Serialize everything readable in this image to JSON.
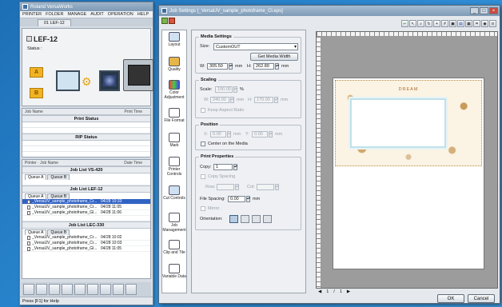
{
  "left_window": {
    "title": "Roland VersaWorks",
    "menu": [
      "PRINTER",
      "FOLDER",
      "MANAGE",
      "AUDIT",
      "OPERATION",
      "HELP"
    ],
    "printer_tab": "01 LEF-12",
    "printer_name": "LEF-12",
    "status_label": "Status :",
    "folder_a": "A",
    "folder_b": "B",
    "job_table_header": {
      "name": "Job Name",
      "time": "Print Time"
    },
    "print_status": "Print Status",
    "rip_status": "RIP Status",
    "queue_table_header": {
      "name": "Printer · Job Name",
      "time": "Date Time"
    },
    "job_list_1": {
      "title": "Job List VS-420",
      "tabs": [
        "Queue A",
        "Queue B"
      ]
    },
    "job_list_2": {
      "title": "Job List LEF-12",
      "tabs": [
        "Queue A",
        "Queue B"
      ],
      "rows": [
        {
          "name": "_VersaUV_sample_photoframe_Cr...",
          "date": "04/28 10:33",
          "selected": true
        },
        {
          "name": "_VersaUV_sample_photoframe_Cr...",
          "date": "04/28 11:05",
          "selected": false
        },
        {
          "name": "_VersaUV_sample_photoframe_Gl...",
          "date": "04/28 11:06",
          "selected": false
        }
      ]
    },
    "job_list_3": {
      "title": "Job List LEC-330",
      "tabs": [
        "Queue A",
        "Queue B"
      ],
      "rows": [
        {
          "name": "_VersaUV_sample_photoframe_Cr...",
          "date": "04/28 10:02",
          "selected": false
        },
        {
          "name": "_VersaUV_sample_photoframe_Cr...",
          "date": "04/28 10:03",
          "selected": false
        },
        {
          "name": "_VersaUV_sample_photoframe_Gl...",
          "date": "04/28 11:05",
          "selected": false
        }
      ]
    },
    "statusbar": "Press [F1] for Help"
  },
  "right_window": {
    "title": "Job Settings [_VersaUV_sample_photoframe_Cl.eps]",
    "sidebar": [
      {
        "label": "Layout",
        "icon": "layout-icon",
        "active": true
      },
      {
        "label": "Quality",
        "icon": "quality-icon",
        "active": false
      },
      {
        "label": "Color Adjustment",
        "icon": "color-adjustment-icon",
        "active": false
      },
      {
        "label": "File Format",
        "icon": "file-format-icon",
        "active": false
      },
      {
        "label": "Mark",
        "icon": "mark-icon",
        "active": false
      },
      {
        "label": "Printer Controls",
        "icon": "printer-controls-icon",
        "active": false
      },
      {
        "label": "Cut Controls",
        "icon": "cut-controls-icon",
        "active": false
      },
      {
        "label": "Job Management",
        "icon": "job-management-icon",
        "active": false
      },
      {
        "label": "Clip and Tile",
        "icon": "clip-and-tile-icon",
        "active": false
      },
      {
        "label": "Variable Data",
        "icon": "variable-data-icon",
        "active": false
      }
    ],
    "media_settings": {
      "title": "Media Settings",
      "size_label": "Size:",
      "size_value": "CustomOUT",
      "get_media_width": "Get Media Width",
      "w_label": "W:",
      "w_value": "305.50",
      "h_label": "H:",
      "h_value": "262.89",
      "unit": "mm"
    },
    "scaling": {
      "title": "Scaling",
      "scale_label": "Scale:",
      "scale_value": "100.00",
      "percent": "%",
      "w_label": "W:",
      "w_value": "240.00",
      "h_label": "H:",
      "h_value": "170.00",
      "unit": "mm",
      "keep_aspect": "Keep Aspect Ratio"
    },
    "position": {
      "title": "Position",
      "x_label": "X:",
      "x_value": "0.00",
      "y_label": "Y:",
      "y_value": "0.00",
      "unit": "mm",
      "center_label": "Center on the Media"
    },
    "print_properties": {
      "title": "Print Properties",
      "copy_label": "Copy:",
      "copy_value": "1",
      "copy_spacing": "Copy Spacing",
      "row_label": "Row:",
      "column_label": "Col:",
      "file_spacing_label": "File Spacing:",
      "file_spacing_value": "0.00",
      "unit": "mm",
      "mirror_label": "Mirror",
      "orientation_label": "Orientation:"
    },
    "preview": {
      "art_title": "DREAM",
      "page_label": "1",
      "page_sep": "/",
      "page_total": "1"
    },
    "ok_label": "OK",
    "cancel_label": "Cancel"
  },
  "colors": {
    "desktop": "#2a86cf",
    "selection": "#3163c4",
    "preview_bg": "#9c9c9c"
  }
}
